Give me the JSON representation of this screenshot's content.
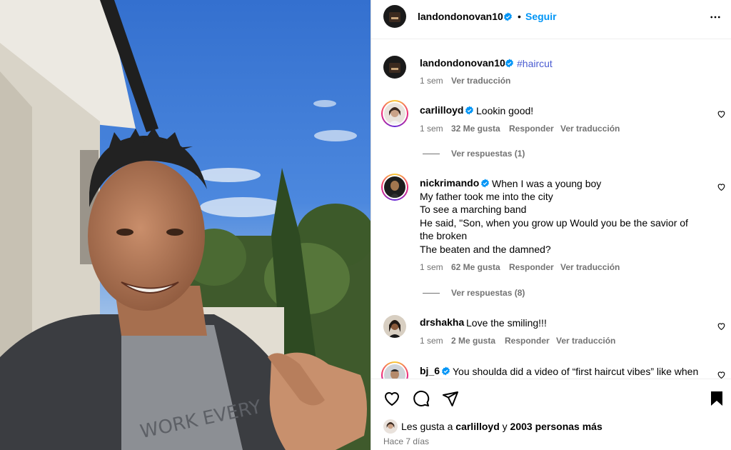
{
  "post": {
    "username": "landondonovan10",
    "follow_label": "Seguir",
    "dot": "•",
    "caption_username": "landondonovan10",
    "caption_hashtag": "#haircut",
    "caption_time": "1 sem",
    "caption_translate": "Ver traducción"
  },
  "comments": [
    {
      "username": "carlilloyd",
      "verified": true,
      "lines": [
        "Lookin good!"
      ],
      "time": "1 sem",
      "likes": "32 Me gusta",
      "reply": "Responder",
      "translate": "Ver traducción",
      "view_replies": "Ver respuestas (1)"
    },
    {
      "username": "nickrimando",
      "verified": true,
      "lines": [
        "When I was a young boy",
        "My father took me into the city",
        "To see a marching band",
        "He said, \"Son, when you grow up Would you be the savior of",
        "the broken",
        "The beaten and the damned?"
      ],
      "time": "1 sem",
      "likes": "62 Me gusta",
      "reply": "Responder",
      "translate": "Ver traducción",
      "view_replies": "Ver respuestas (8)"
    },
    {
      "username": "drshakha",
      "verified": false,
      "lines": [
        "Love the smiling!!!"
      ],
      "time": "1 sem",
      "likes": "2 Me gusta",
      "reply": "Responder",
      "translate": "Ver traducción"
    },
    {
      "username": "bj_6",
      "verified": true,
      "lines": [
        "You shoulda did a video of “first haircut vibes” like when"
      ]
    }
  ],
  "footer": {
    "likes_prefix": "Les gusta a",
    "likes_user": "carlilloyd",
    "likes_and": "y",
    "likes_rest": "2003 personas más",
    "time_ago": "Hace 7 días"
  },
  "icons": {
    "like": "heart-icon",
    "comment": "comment-icon",
    "share": "send-icon",
    "save": "bookmark-icon",
    "more": "more-options-icon",
    "verified": "verified-badge-icon"
  },
  "colors": {
    "link_blue": "#0095f6",
    "hashtag": "#4a5bd1",
    "verified": "#0095f6",
    "muted": "#737373"
  }
}
